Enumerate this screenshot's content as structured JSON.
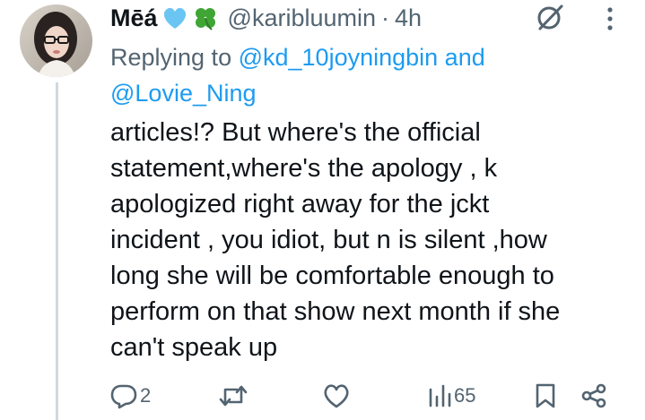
{
  "tweet": {
    "author_name": "Mēá",
    "emojis": [
      "blue-heart-emoji",
      "four-leaf-clover-emoji"
    ],
    "handle": "@karibluumin",
    "separator": "·",
    "time": "4h",
    "replying_prefix": "Replying to ",
    "replying_mentions": [
      "@kd_10joyningbin",
      "@Lovie_Ning"
    ],
    "replying_joiner": " and",
    "body_lines": [
      "articles!? But where's the official",
      "statement,where's the apology , k",
      "apologized right away for the jckt",
      "incident , you idiot, but n is silent ,how",
      "long she will be comfortable enough to",
      "perform on that show next month if she",
      "can't speak up"
    ]
  },
  "actions": {
    "reply_count": "2",
    "retweet_count": "",
    "like_count": "",
    "views_count": "65"
  },
  "colors": {
    "text_primary": "#0f1419",
    "text_secondary": "#536471",
    "link": "#1d9bf0",
    "thread_line": "#cfd9de"
  },
  "icons": [
    "avatar",
    "grok-icon",
    "more-icon",
    "reply-icon",
    "retweet-icon",
    "like-icon",
    "views-icon",
    "bookmark-icon",
    "share-icon"
  ]
}
